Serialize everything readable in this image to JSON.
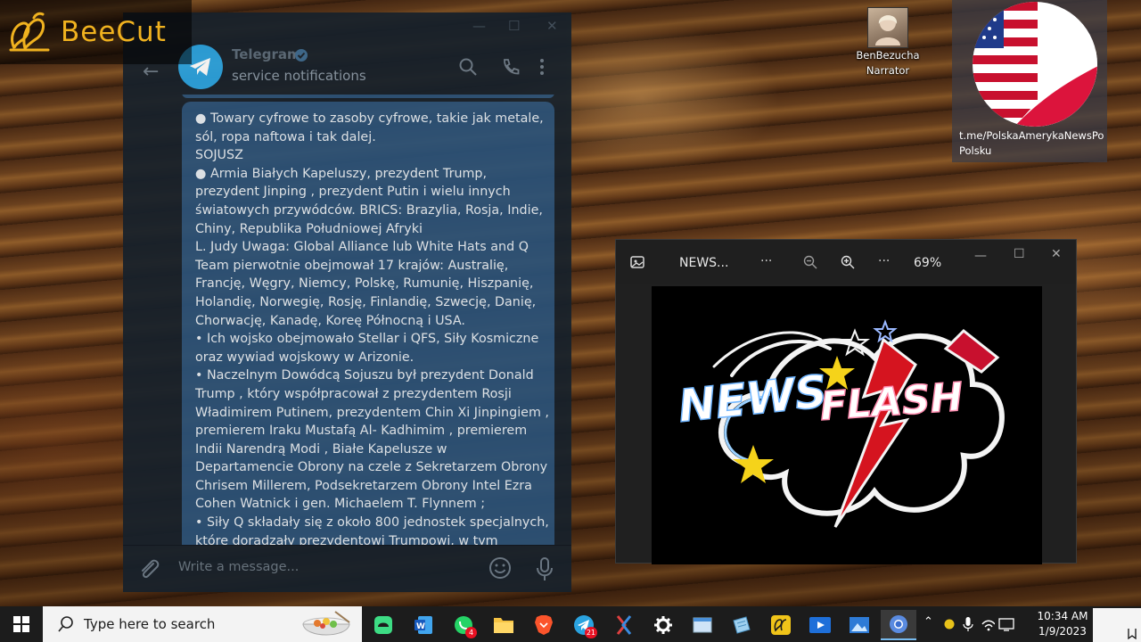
{
  "watermark": {
    "brand": "BeeCut"
  },
  "telegram": {
    "chat_title": "Telegram",
    "chat_subtitle": "service notifications",
    "message_lines": [
      "● Towary cyfrowe to zasoby cyfrowe, takie jak metale,",
      "sól, ropa naftowa i tak dalej.",
      "SOJUSZ",
      "● Armia Białych Kapeluszy, prezydent Trump,",
      "prezydent Jinping , prezydent Putin i wielu innych",
      "światowych przywódców. BRICS: Brazylia, Rosja, Indie,",
      "Chiny, Republika Południowej Afryki",
      "L. Judy Uwaga: Global Alliance lub White Hats and Q",
      "Team pierwotnie obejmował 17 krajów: Australię,",
      "Francję, Węgry, Niemcy, Polskę, Rumunię, Hiszpanię,",
      "Holandię, Norwegię, Rosję, Finlandię, Szwecję, Danię,",
      "Chorwację, Kanadę, Koreę Północną i USA.",
      "•  Ich wojsko obejmowało Stellar i QFS, Siły Kosmiczne",
      "oraz wywiad wojskowy w Arizonie.",
      "•  Naczelnym Dowódcą Sojuszu był prezydent Donald",
      "Trump , który współpracował z prezydentem Rosji",
      "Władimirem Putinem, prezydentem Chin Xi Jinpingiem ,",
      "premierem Iraku Mustafą Al- Kadhimim , premierem",
      "Indii Narendrą Modi , Białe Kapelusze w",
      "Departamencie Obrony na czele z Sekretarzem Obrony",
      "Chrisem Millerem, Podsekretarzem Obrony Intel Ezra",
      "Cohen Watnick i gen. Michaelem T. Flynnem ;",
      "•  Siły Q składały się z około 800 jednostek specjalnych,",
      "które doradzały prezydentowi Trumpowi, w tym"
    ],
    "composer_placeholder": "Write a message..."
  },
  "desktop": {
    "user_icon_label_line1": "BenBezucha",
    "user_icon_label_line2": "Narrator",
    "channel_label_line1": "t.me/PolskaAmerykaNewsPo",
    "channel_label_line2": "Polsku"
  },
  "photo_viewer": {
    "file_name": "NEWS...",
    "zoom_level": "69%",
    "image_text_1": "NEWS",
    "image_text_2": "FLASH"
  },
  "taskbar": {
    "search_placeholder": "Type here to search",
    "whatsapp_badge": "4",
    "telegram_badge": "21",
    "clock_time": "10:34 AM",
    "clock_date": "1/9/2023"
  },
  "colors": {
    "telegram_bg": "#17212b",
    "bubble": "#2b5278",
    "watermark_gold": "#f0b21f",
    "taskbar": "#1c1c1c"
  }
}
